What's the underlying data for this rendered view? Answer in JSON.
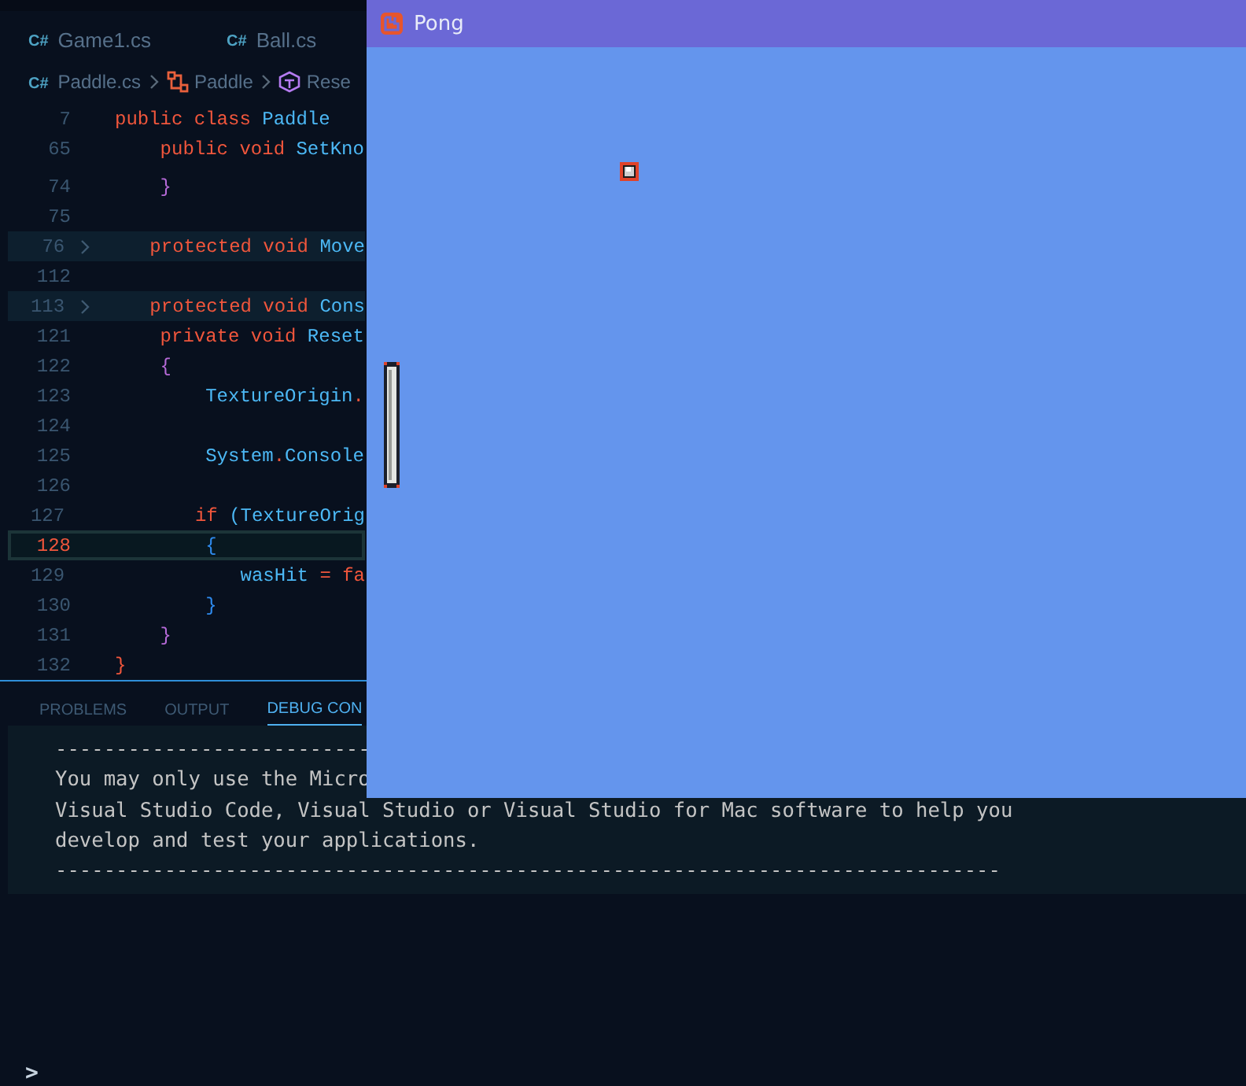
{
  "editor": {
    "tabs": [
      {
        "icon": "C#",
        "label": "Game1.cs",
        "selected": false
      },
      {
        "icon": "C#",
        "label": "Ball.cs",
        "selected": false
      }
    ],
    "breadcrumb": [
      {
        "kind": "file",
        "icon": "C#",
        "label": "Paddle.cs"
      },
      {
        "kind": "class",
        "label": "Paddle"
      },
      {
        "kind": "method",
        "label": "Rese"
      }
    ],
    "sticky_lines": [
      {
        "number": "7",
        "folded": false,
        "current": false,
        "tokens": [
          {
            "text": "public class ",
            "kind": "kw"
          },
          {
            "text": "Paddle",
            "kind": "id"
          }
        ]
      },
      {
        "number": "65",
        "folded": false,
        "current": false,
        "tokens": [
          {
            "text": "    public void ",
            "kind": "kw"
          },
          {
            "text": "SetKno",
            "kind": "id"
          }
        ]
      }
    ],
    "lines": [
      {
        "number": "74",
        "folded": false,
        "current": false,
        "tokens": [
          {
            "text": "    }",
            "kind": "brace2"
          }
        ]
      },
      {
        "number": "75",
        "folded": false,
        "current": false
      },
      {
        "number": "76",
        "folded": true,
        "current": false,
        "tokens": [
          {
            "text": "    protected void ",
            "kind": "kw"
          },
          {
            "text": "Move",
            "kind": "id"
          }
        ]
      },
      {
        "number": "112",
        "folded": false,
        "current": false
      },
      {
        "number": "113",
        "folded": true,
        "current": false,
        "tokens": [
          {
            "text": "    protected void ",
            "kind": "kw"
          },
          {
            "text": "Cons",
            "kind": "id"
          }
        ]
      },
      {
        "number": "121",
        "folded": false,
        "current": false,
        "tokens": [
          {
            "text": "    private void ",
            "kind": "kw"
          },
          {
            "text": "Reset",
            "kind": "id"
          }
        ]
      },
      {
        "number": "122",
        "folded": false,
        "current": false,
        "tokens": [
          {
            "text": "    {",
            "kind": "brace2"
          }
        ]
      },
      {
        "number": "123",
        "folded": false,
        "current": false,
        "tokens": [
          {
            "text": "        TextureOrigin",
            "kind": "id"
          },
          {
            "text": ".",
            "kind": "op"
          }
        ]
      },
      {
        "number": "124",
        "folded": false,
        "current": false
      },
      {
        "number": "125",
        "folded": false,
        "current": false,
        "tokens": [
          {
            "text": "        System",
            "kind": "id"
          },
          {
            "text": ".",
            "kind": "op"
          },
          {
            "text": "Console",
            "kind": "id"
          }
        ]
      },
      {
        "number": "126",
        "folded": false,
        "current": false
      },
      {
        "number": "127",
        "folded": false,
        "current": false,
        "tokens": [
          {
            "text": "        if ",
            "kind": "kw"
          },
          {
            "text": "(TextureOrig",
            "kind": "id"
          }
        ]
      },
      {
        "number": "128",
        "folded": false,
        "current": true,
        "tokens": [
          {
            "text": "        {",
            "kind": "brace3"
          }
        ]
      },
      {
        "number": "129",
        "folded": false,
        "current": false,
        "tokens": [
          {
            "text": "            wasHit ",
            "kind": "id"
          },
          {
            "text": "= fa",
            "kind": "op"
          }
        ]
      },
      {
        "number": "130",
        "folded": false,
        "current": false,
        "tokens": [
          {
            "text": "        }",
            "kind": "brace3"
          }
        ]
      },
      {
        "number": "131",
        "folded": false,
        "current": false,
        "tokens": [
          {
            "text": "    }",
            "kind": "brace2"
          }
        ]
      },
      {
        "number": "132",
        "folded": false,
        "current": false,
        "tokens": [
          {
            "text": "}",
            "kind": "brace1"
          }
        ]
      }
    ]
  },
  "panel": {
    "tabs": [
      {
        "label": "PROBLEMS",
        "selected": false
      },
      {
        "label": "OUTPUT",
        "selected": false
      },
      {
        "label": "DEBUG CON",
        "selected": true
      }
    ],
    "console_lines": [
      "--------------------------",
      "You may only use the Micro",
      "Visual Studio Code, Visual Studio or Visual Studio for Mac software to help you",
      "develop and test your applications.",
      "------------------------------------------------------------------------------"
    ],
    "prompt": ">"
  },
  "game_window": {
    "title": "Pong"
  }
}
